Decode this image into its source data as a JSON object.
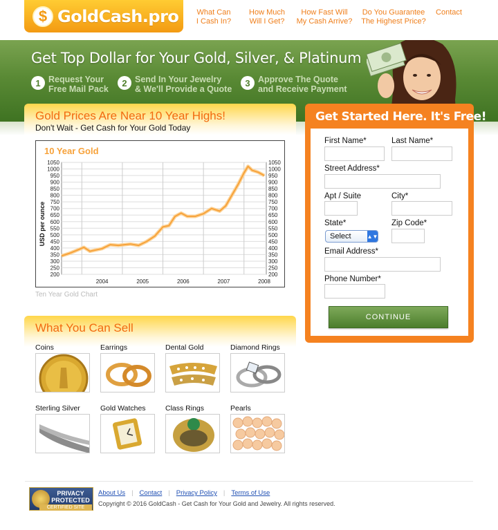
{
  "header": {
    "logo_symbol": "$",
    "logo_text": "GoldCash.pro",
    "nav": [
      {
        "line1": "What Can",
        "line2": "I Cash In?"
      },
      {
        "line1": "How Much",
        "line2": "Will I Get?"
      },
      {
        "line1": "How Fast Will",
        "line2": "My Cash Arrive?"
      },
      {
        "line1": "Do You Guarantee",
        "line2": "The Highest Price?"
      },
      {
        "line1": "Contact",
        "line2": ""
      }
    ]
  },
  "banner": {
    "title": "Get Top Dollar for Your Gold, Silver, & Platinum",
    "steps": [
      {
        "num": "1",
        "line1": "Request Your",
        "line2": "Free Mail Pack"
      },
      {
        "num": "2",
        "line1": "Send In Your Jewelry",
        "line2": "& We'll Provide a Quote"
      },
      {
        "num": "3",
        "line1": "Approve The Quote",
        "line2": "and Receive Payment"
      }
    ]
  },
  "gold_prices": {
    "title": "Gold Prices Are Near 10 Year Highs!",
    "subtitle": "Don't Wait - Get Cash for Your Gold Today",
    "caption": "Ten Year Gold Chart"
  },
  "chart_data": {
    "type": "line",
    "title": "10 Year Gold",
    "ylabel": "USD per ounce",
    "xlabel": "",
    "x_ticks": [
      "2004",
      "2005",
      "2006",
      "2007",
      "2008"
    ],
    "y_ticks": [
      200,
      250,
      300,
      350,
      400,
      450,
      500,
      550,
      600,
      650,
      700,
      750,
      800,
      850,
      900,
      950,
      1000,
      1050
    ],
    "ylim": [
      200,
      1050
    ],
    "xlim": [
      2003.5,
      2008.55
    ],
    "grid": true,
    "series": [
      {
        "color": "#f7a23a",
        "x": [
          2003.5,
          2003.7,
          2003.9,
          2004.05,
          2004.2,
          2004.35,
          2004.5,
          2004.7,
          2004.9,
          2005.05,
          2005.2,
          2005.4,
          2005.6,
          2005.8,
          2006.0,
          2006.15,
          2006.3,
          2006.45,
          2006.6,
          2006.8,
          2007.0,
          2007.2,
          2007.4,
          2007.55,
          2007.7,
          2007.85,
          2008.0,
          2008.1,
          2008.2,
          2008.35,
          2008.5
        ],
        "y": [
          340,
          360,
          385,
          405,
          375,
          385,
          395,
          425,
          420,
          425,
          430,
          420,
          450,
          490,
          560,
          570,
          640,
          665,
          640,
          640,
          660,
          700,
          680,
          720,
          800,
          880,
          970,
          1020,
          990,
          975,
          950
        ]
      }
    ]
  },
  "sell": {
    "title": "What You Can Sell",
    "items": [
      "Coins",
      "Earrings",
      "Dental Gold",
      "Diamond Rings",
      "Sterling Silver",
      "Gold Watches",
      "Class Rings",
      "Pearls"
    ]
  },
  "form": {
    "title": "Get Started Here. It's Free!",
    "first_name": "First Name*",
    "last_name": "Last Name*",
    "street": "Street Address*",
    "apt": "Apt / Suite",
    "city": "City*",
    "state": "State*",
    "state_selected": "Select",
    "zip": "Zip Code*",
    "email": "Email Address*",
    "phone": "Phone Number*",
    "continue": "CONTINUE"
  },
  "footer": {
    "badge_line1": "PRIVACY",
    "badge_line2": "PROTECTED",
    "badge_line3": "CERTIFIED SITE",
    "links": [
      "About Us",
      "Contact",
      "Privacy Policy",
      "Terms of Use"
    ],
    "copyright": "Copyright © 2016 GoldCash - Get Cash for Your Gold and Jewelry. All rights reserved."
  },
  "colors": {
    "accent_orange": "#f58220",
    "heading_orange": "#f26a0f",
    "banner_green": "#5a8a35",
    "link_blue": "#1f4fb3"
  }
}
